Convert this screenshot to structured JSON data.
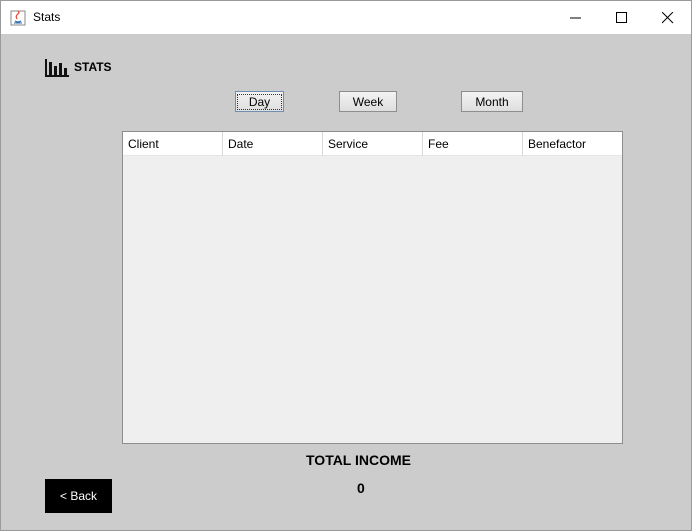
{
  "window": {
    "title": "Stats"
  },
  "header": {
    "label": "STATS",
    "icon": "bar-chart-icon"
  },
  "period_buttons": {
    "day": "Day",
    "week": "Week",
    "month": "Month"
  },
  "table": {
    "columns": [
      "Client",
      "Date",
      "Service",
      "Fee",
      "Benefactor"
    ],
    "rows": []
  },
  "summary": {
    "total_label": "TOTAL INCOME",
    "total_value": "0"
  },
  "footer": {
    "back_label": "< Back"
  },
  "colors": {
    "background": "#cccccc",
    "back_button": "#000000"
  }
}
